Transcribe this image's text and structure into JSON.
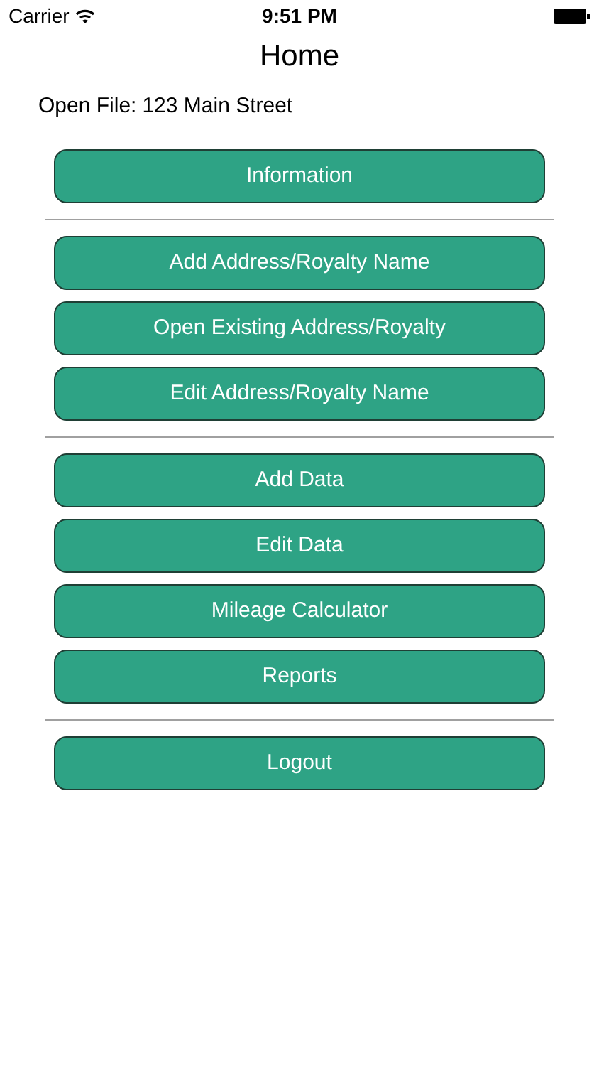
{
  "status_bar": {
    "carrier": "Carrier",
    "time": "9:51 PM"
  },
  "nav": {
    "title": "Home"
  },
  "open_file": {
    "label": "Open File:",
    "value": "123 Main Street"
  },
  "groups": [
    [
      "Information"
    ],
    [
      "Add Address/Royalty Name",
      "Open Existing Address/Royalty",
      "Edit Address/Royalty Name"
    ],
    [
      "Add Data",
      "Edit Data",
      "Mileage Calculator",
      "Reports"
    ],
    [
      "Logout"
    ]
  ]
}
